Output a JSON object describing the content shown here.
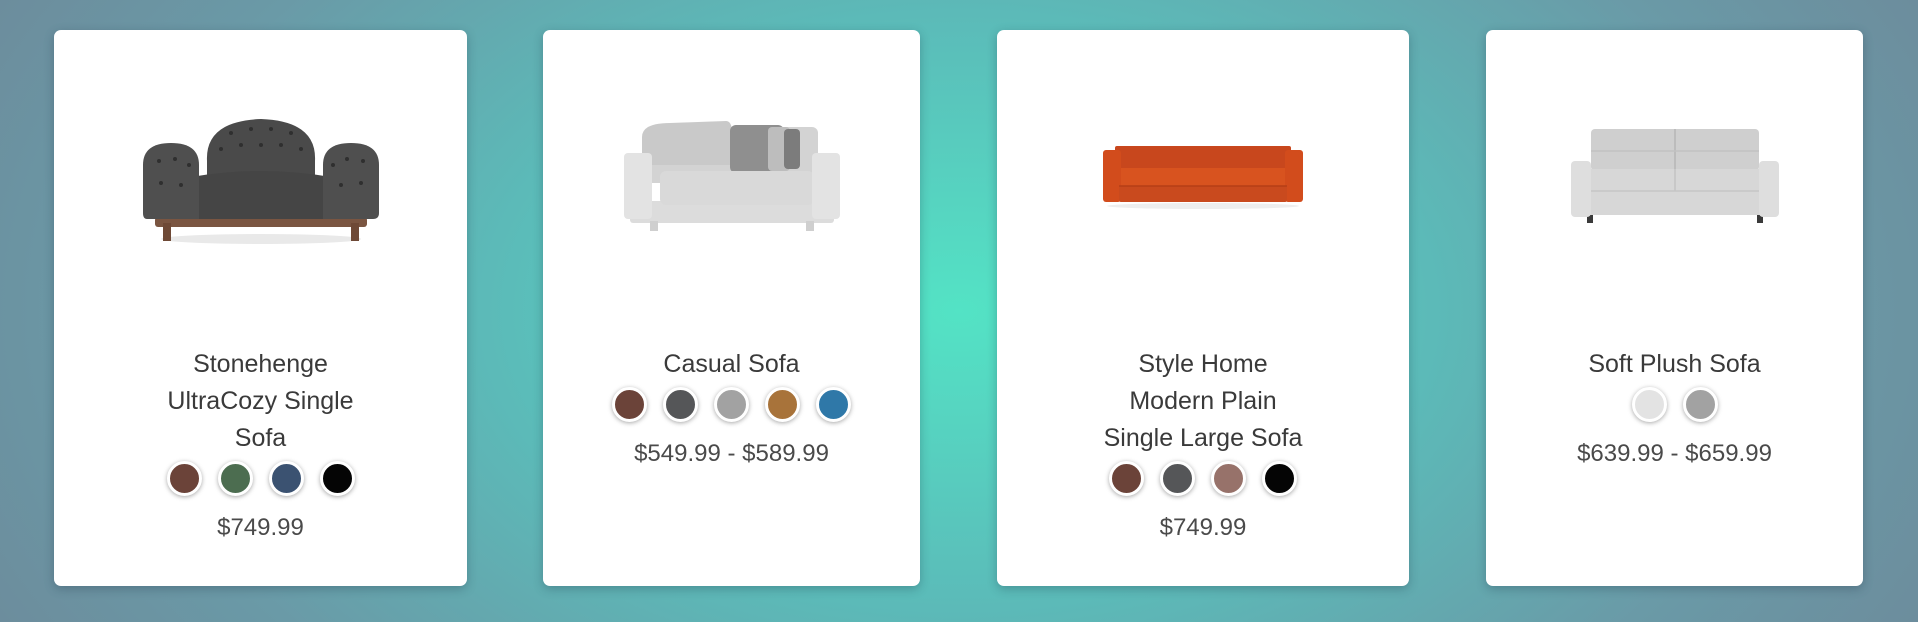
{
  "products": [
    {
      "name_lines": [
        "Stonehenge",
        "UltraCozy Single",
        "Sofa"
      ],
      "image_icon": "tufted-armchair-icon",
      "swatches": [
        "#6b4339",
        "#4c6d50",
        "#3b5271",
        "#050505"
      ],
      "price": "$749.99"
    },
    {
      "name_lines": [
        "Casual Sofa"
      ],
      "image_icon": "light-gray-sofa-icon",
      "swatches": [
        "#6b4339",
        "#555658",
        "#a2a2a2",
        "#a8733a",
        "#2f78a8"
      ],
      "price": "$549.99 - $589.99"
    },
    {
      "name_lines": [
        "Style Home",
        "Modern Plain",
        "Single Large Sofa"
      ],
      "image_icon": "orange-sofa-icon",
      "swatches": [
        "#6b4339",
        "#555658",
        "#97726a",
        "#050505"
      ],
      "price": "$749.99"
    },
    {
      "name_lines": [
        "Soft Plush Sofa"
      ],
      "image_icon": "tufted-gray-sofa-icon",
      "swatches": [
        "#e3e3e3",
        "#a2a2a2"
      ],
      "price": "$639.99 - $659.99"
    }
  ]
}
